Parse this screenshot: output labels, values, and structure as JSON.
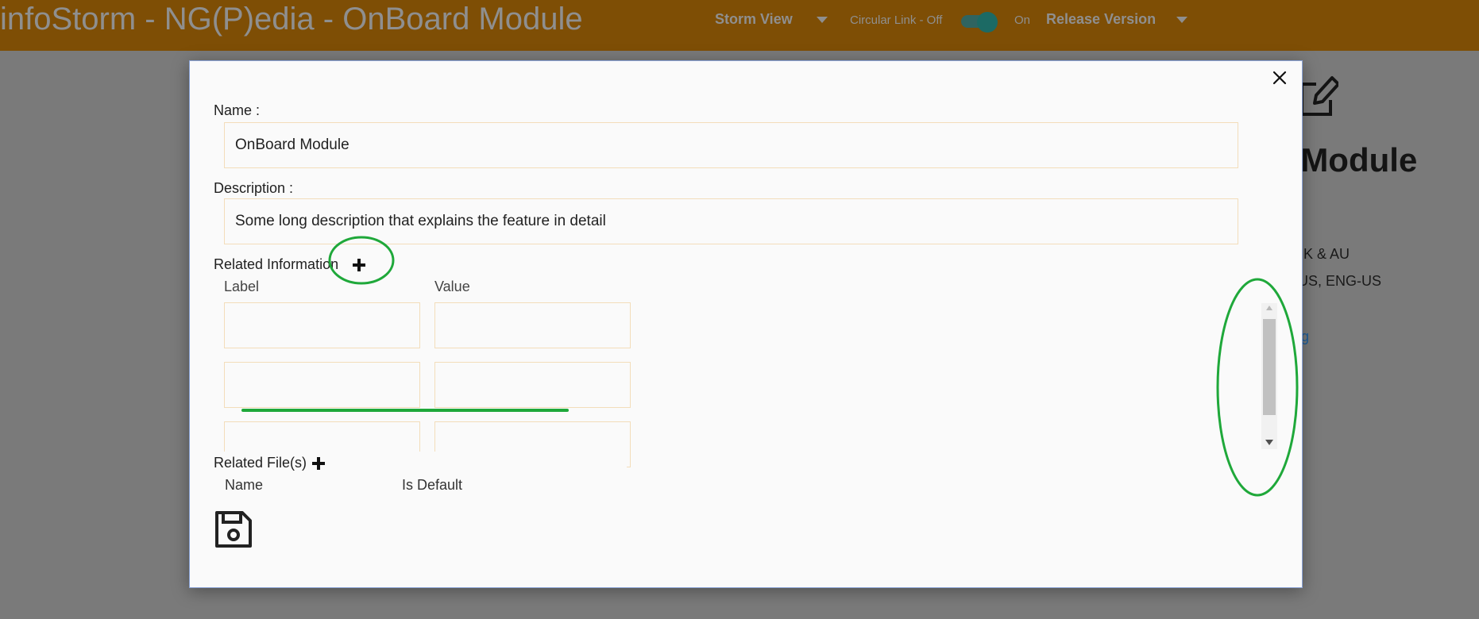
{
  "header": {
    "app_title": "infoStorm - NG(P)edia - OnBoard Module",
    "storm_view_label": "Storm View",
    "circular_link_label": "Circular Link - Off",
    "on_label": "On",
    "release_version_label": "Release Version",
    "circular_link_toggle": "on"
  },
  "background_page": {
    "title_fragment": "d Module",
    "line1": "UK & AU",
    "line2": "-US, ENG-US",
    "link_fragment": "ng"
  },
  "modal": {
    "name_label": "Name :",
    "name_value": "OnBoard Module",
    "description_label": "Description :",
    "description_value": "Some long description that explains the feature in detail",
    "related_info_label": "Related Information",
    "label_col": "Label",
    "value_col": "Value",
    "related_files_label": "Related File(s)",
    "file_name_col": "Name",
    "is_default_col": "Is Default"
  },
  "icons": {
    "close": "close-icon",
    "add_related_info": "plus-icon",
    "add_related_file": "plus-icon",
    "save": "floppy-disk-icon",
    "edit": "pencil-edit-icon"
  },
  "colors": {
    "topbar": "#7e4e05",
    "overlay": "#7a7a7a",
    "modal_bg": "#fafafa",
    "input_border": "#f3ddba",
    "annotation_green": "#1fa83a",
    "toggle": "#1c6a64"
  }
}
